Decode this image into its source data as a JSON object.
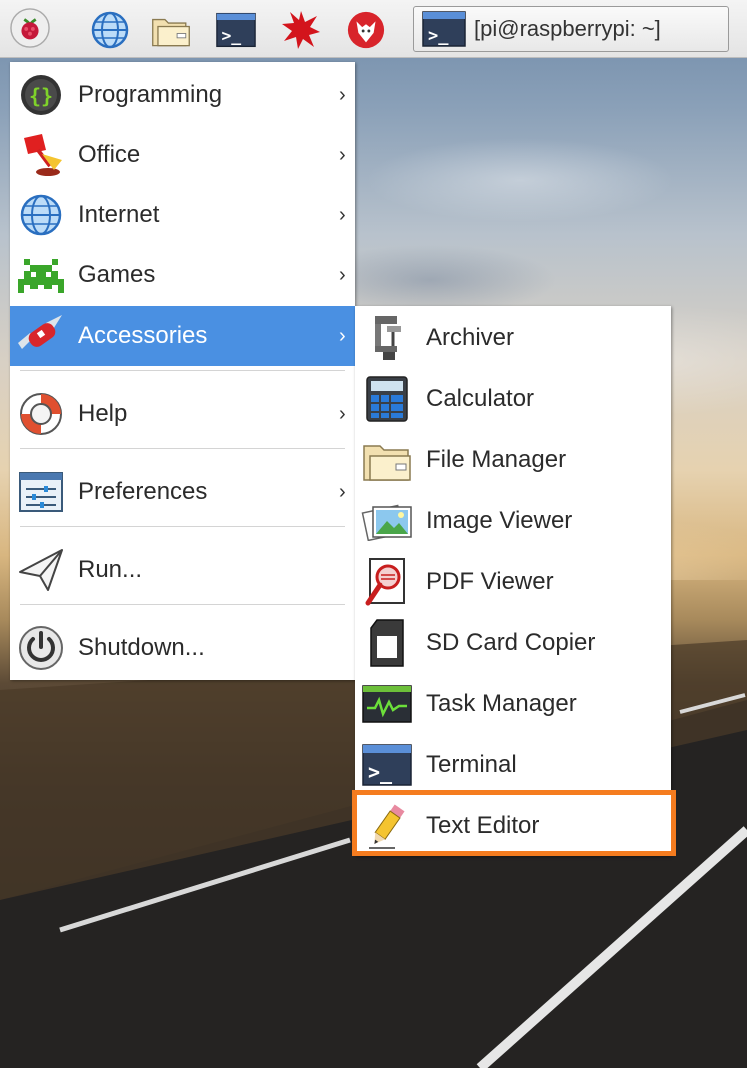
{
  "taskbar": {
    "launchers": [
      {
        "icon": "raspberry-menu-icon"
      },
      {
        "icon": "globe-icon"
      },
      {
        "icon": "folder-icon"
      },
      {
        "icon": "terminal-icon"
      },
      {
        "icon": "mathematica-icon"
      },
      {
        "icon": "wolfram-icon"
      }
    ],
    "window_button": {
      "icon": "terminal-icon",
      "label": "[pi@raspberrypi: ~]"
    }
  },
  "menu": {
    "items": [
      {
        "label": "Programming",
        "icon": "programming-icon",
        "submenu": true
      },
      {
        "label": "Office",
        "icon": "office-lamp-icon",
        "submenu": true
      },
      {
        "label": "Internet",
        "icon": "globe-icon",
        "submenu": true
      },
      {
        "label": "Games",
        "icon": "space-invader-icon",
        "submenu": true
      },
      {
        "label": "Accessories",
        "icon": "swiss-knife-icon",
        "submenu": true,
        "active": true
      },
      {
        "label": "Help",
        "icon": "lifebuoy-icon",
        "submenu": true
      },
      {
        "label": "Preferences",
        "icon": "preferences-icon",
        "submenu": true
      },
      {
        "label": "Run...",
        "icon": "paper-plane-icon",
        "submenu": false
      },
      {
        "label": "Shutdown...",
        "icon": "power-icon",
        "submenu": false
      }
    ],
    "arrow": "›"
  },
  "submenu": {
    "items": [
      {
        "label": "Archiver",
        "icon": "clamp-icon"
      },
      {
        "label": "Calculator",
        "icon": "calculator-icon"
      },
      {
        "label": "File Manager",
        "icon": "folder-icon"
      },
      {
        "label": "Image Viewer",
        "icon": "image-icon"
      },
      {
        "label": "PDF Viewer",
        "icon": "pdf-magnifier-icon"
      },
      {
        "label": "SD Card Copier",
        "icon": "sd-card-icon"
      },
      {
        "label": "Task Manager",
        "icon": "task-monitor-icon"
      },
      {
        "label": "Terminal",
        "icon": "terminal-icon"
      },
      {
        "label": "Text Editor",
        "icon": "pencil-icon",
        "highlighted": true
      }
    ]
  },
  "colors": {
    "active_item": "#4a90e2",
    "highlight_border": "#f57c1f"
  }
}
